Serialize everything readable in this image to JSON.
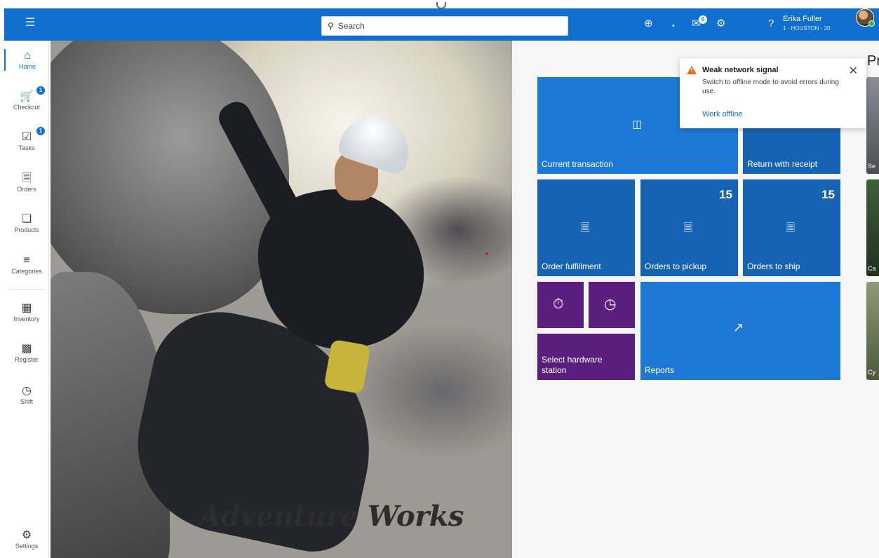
{
  "topbar": {
    "menu_icon": "hamburger-icon",
    "search_placeholder": "Search",
    "icons": [
      "store-connect-icon",
      "wifi-icon",
      "notifications-icon",
      "settings-gear-icon",
      "help-icon"
    ],
    "notification_count": "0",
    "user": {
      "name": "Erika Fuller",
      "store": "1 - HOUSTON - 20"
    }
  },
  "sidebar": {
    "items": [
      {
        "label": "Home",
        "icon": "home-icon",
        "active": true
      },
      {
        "label": "Checkout",
        "icon": "cart-icon",
        "badge": "1"
      },
      {
        "label": "Tasks",
        "icon": "tasks-icon",
        "badge": "1"
      },
      {
        "label": "Orders",
        "icon": "orders-icon"
      },
      {
        "label": "Products",
        "icon": "box-icon"
      },
      {
        "label": "Categories",
        "icon": "categories-icon"
      },
      {
        "label": "Inventory",
        "icon": "inventory-icon"
      },
      {
        "label": "Register",
        "icon": "register-icon"
      },
      {
        "label": "Shift",
        "icon": "shift-icon"
      }
    ],
    "settings": {
      "label": "Settings",
      "icon": "settings-icon"
    }
  },
  "hero": {
    "brand": "Adventure Works"
  },
  "tiles": {
    "current_transaction": "Current transaction",
    "return_with_receipt": "Return with receipt",
    "order_fulfillment": "Order fulfillment",
    "orders_to_pickup": {
      "label": "Orders to pickup",
      "count": "15"
    },
    "orders_to_ship": {
      "label": "Orders to ship",
      "count": "15"
    },
    "select_hardware_station": "Select hardware station",
    "reports": "Reports"
  },
  "toast": {
    "title": "Weak network signal",
    "body": "Switch to offline mode to avoid errors during use.",
    "link": "Work offline"
  },
  "right_panel": {
    "title_fragment": "Pr",
    "card_fragments": [
      "Se",
      "Ca",
      "Cy"
    ]
  },
  "colors": {
    "accent": "#1170cf",
    "tile_blue": "#1e78d6",
    "tile_purple": "#5a1e7e",
    "warning": "#e36b1c"
  }
}
